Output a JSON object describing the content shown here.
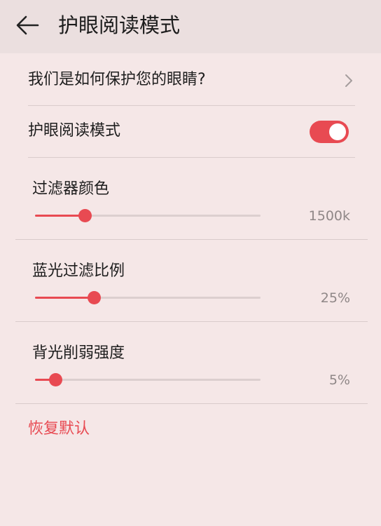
{
  "header": {
    "title": "护眼阅读模式"
  },
  "protect_link": {
    "label": "我们是如何保护您的眼睛?"
  },
  "eye_mode": {
    "label": "护眼阅读模式",
    "enabled": true
  },
  "sliders": [
    {
      "label": "过滤器颜色",
      "value_text": "1500k",
      "level": 0.22
    },
    {
      "label": "蓝光过滤比例",
      "value_text": "25%",
      "level": 0.26
    },
    {
      "label": "背光削弱强度",
      "value_text": "5%",
      "level": 0.09
    }
  ],
  "restore": {
    "label": "恢复默认"
  },
  "colors": {
    "accent": "#e84a52",
    "background": "#f5e7e7",
    "header": "#ebdfdf"
  },
  "icons": {
    "back": "arrow-left-icon",
    "chevron": "chevron-right-icon"
  }
}
